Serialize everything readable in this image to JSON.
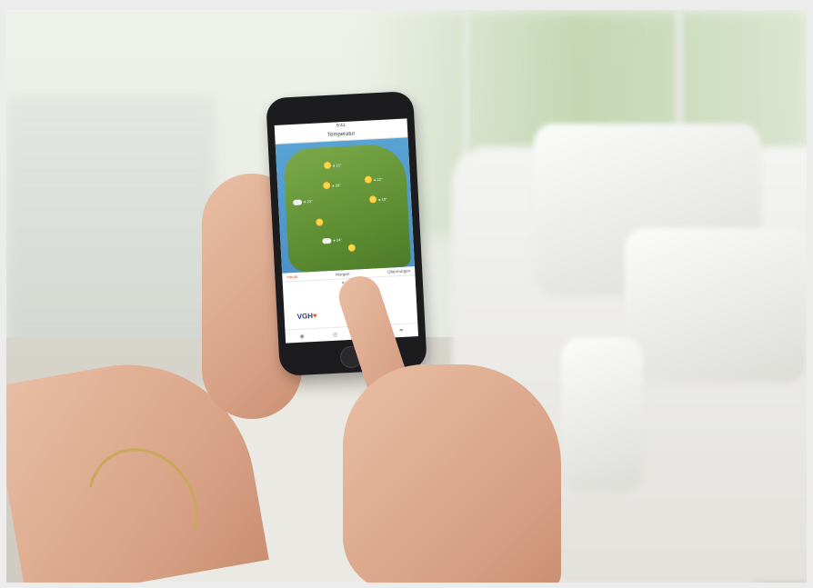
{
  "scene": {
    "background_color": "#ececec"
  },
  "phone_app": {
    "status_time": "9:41",
    "title": "Temperatur",
    "map_labels": [
      {
        "label": "● 21°"
      },
      {
        "label": "● 22°"
      },
      {
        "label": "● 20°"
      },
      {
        "label": "● 23°"
      },
      {
        "label": "● 19°"
      },
      {
        "label": "● 24°"
      }
    ],
    "day_tabs": [
      "Heute",
      "Morgen",
      "Übermorgen"
    ],
    "active_tab": "Heute",
    "page_dots": "● ● ● ○",
    "logo_main": "VGH",
    "logo_accent": "♥",
    "tab_icons": [
      "map-icon",
      "camera-icon",
      "settings-icon",
      "umbrella-icon"
    ],
    "tab_glyphs": [
      "◉",
      "◎",
      "✱",
      "☂"
    ]
  },
  "colors": {
    "brand": "#2a3a80",
    "accent": "#e8562c"
  }
}
